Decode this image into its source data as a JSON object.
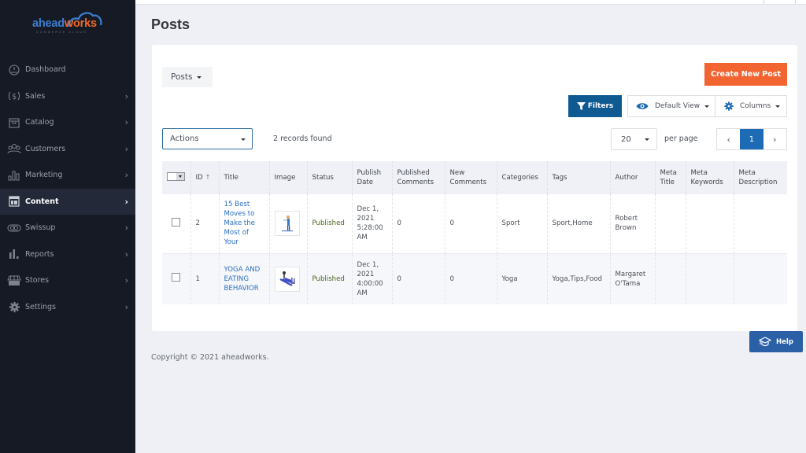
{
  "brand": {
    "name_part1": "ahead",
    "name_part2": "works",
    "tagline": "COMMERCE CLOUD",
    "color_primary": "#3c7fd3",
    "color_accent": "#f06a2a"
  },
  "sidebar": {
    "items": [
      {
        "label": "Dashboard",
        "icon": "dashboard-icon",
        "has_chevron": false,
        "active": false
      },
      {
        "label": "Sales",
        "icon": "dollar-icon",
        "has_chevron": true,
        "active": false
      },
      {
        "label": "Catalog",
        "icon": "box-icon",
        "has_chevron": true,
        "active": false
      },
      {
        "label": "Customers",
        "icon": "users-icon",
        "has_chevron": true,
        "active": false
      },
      {
        "label": "Marketing",
        "icon": "bar-chart-icon",
        "has_chevron": true,
        "active": false
      },
      {
        "label": "Content",
        "icon": "layout-icon",
        "has_chevron": true,
        "active": true
      },
      {
        "label": "Swissup",
        "icon": "toggle-icon",
        "has_chevron": true,
        "active": false
      },
      {
        "label": "Reports",
        "icon": "reports-icon",
        "has_chevron": true,
        "active": false
      },
      {
        "label": "Stores",
        "icon": "store-icon",
        "has_chevron": true,
        "active": false
      },
      {
        "label": "Settings",
        "icon": "gear-icon",
        "has_chevron": true,
        "active": false
      }
    ]
  },
  "page": {
    "title": "Posts"
  },
  "toolbar": {
    "posts_switch_label": "Posts",
    "create_label": "Create New Post",
    "filters_label": "Filters",
    "default_view_label": "Default View",
    "columns_label": "Columns",
    "actions_label": "Actions",
    "records_found": "2 records found",
    "per_page_value": "20",
    "per_page_label": "per page",
    "current_page": "1",
    "prev_symbol": "‹",
    "next_symbol": "›",
    "create_color": "#f26430",
    "filters_color": "#0f5a91"
  },
  "table": {
    "columns": [
      "ID",
      "Title",
      "Image",
      "Status",
      "Publish Date",
      "Published Comments",
      "New Comments",
      "Categories",
      "Tags",
      "Author",
      "Meta Title",
      "Meta Keywords",
      "Meta Description"
    ],
    "sort_indicator": "↑",
    "rows": [
      {
        "id": "2",
        "title": "15 Best Moves to Make the Most of Your",
        "image": "fitness-thumbnail",
        "status": "Published",
        "publish_date": "Dec 1, 2021 5:28:00 AM",
        "published_comments": "0",
        "new_comments": "0",
        "categories": "Sport",
        "tags": "Sport,Home",
        "author": "Robert Brown",
        "meta_title": "",
        "meta_keywords": "",
        "meta_description": ""
      },
      {
        "id": "1",
        "title": "YOGA AND EATING BEHAVIOR",
        "image": "yoga-thumbnail",
        "status": "Published",
        "publish_date": "Dec 1, 2021 4:00:00 AM",
        "published_comments": "0",
        "new_comments": "0",
        "categories": "Yoga",
        "tags": "Yoga,Tips,Food",
        "author": "Margaret O'Tama",
        "meta_title": "",
        "meta_keywords": "",
        "meta_description": ""
      }
    ]
  },
  "footer": {
    "copyright": "Copyright © 2021 aheadworks.",
    "help_label": "Help"
  }
}
